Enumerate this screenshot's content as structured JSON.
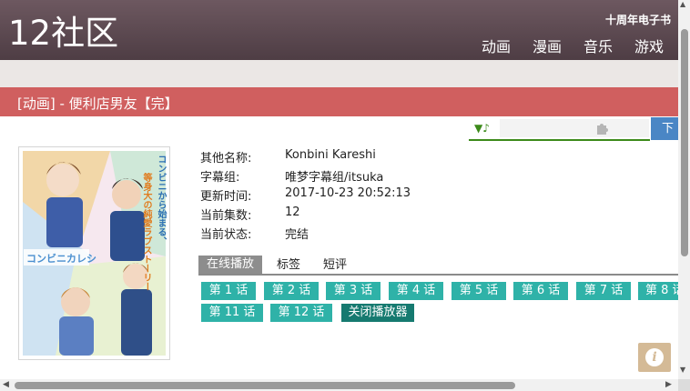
{
  "header": {
    "logo": "12社区",
    "ebook_link": "十周年电子书",
    "nav": [
      "动画",
      "漫画",
      "音乐",
      "游戏"
    ]
  },
  "title_bar": {
    "text": "[动画] - 便利店男友【完】"
  },
  "music_player": {
    "control": "▼♪",
    "plugin_icon": "puzzle-icon"
  },
  "next_button": {
    "label": "下"
  },
  "info": {
    "rows": [
      {
        "key": "其他名称:",
        "value": "Konbini Kareshi"
      },
      {
        "key": "字幕组:",
        "value": "唯梦字幕组/itsuka"
      },
      {
        "key": "更新时间:",
        "value": "2017-10-23 20:52:13"
      },
      {
        "key": "当前集数:",
        "value": "12"
      },
      {
        "key": "当前状态:",
        "value": "完结"
      }
    ]
  },
  "poster": {
    "logo_text": "コンビニカレシ",
    "tagline_1": "コンビニから始まる、",
    "tagline_2": "等身大の純愛ラブストーリー"
  },
  "tabs": [
    "在线播放",
    "标签",
    "短评"
  ],
  "episodes": [
    "第 1 话",
    "第 2 话",
    "第 3 话",
    "第 4 话",
    "第 5 话",
    "第 6 话",
    "第 7 话",
    "第 8 话",
    "第 11 话",
    "第 12 话"
  ],
  "close_player": "关闭播放器",
  "info_button": {
    "label": "i"
  },
  "colors": {
    "header": "#5c4850",
    "title_bar": "#d05f5f",
    "episode": "#2fb2a8",
    "close_player": "#167a70",
    "next_button": "#4a86c5",
    "music_bar": "#3c8a1a"
  }
}
